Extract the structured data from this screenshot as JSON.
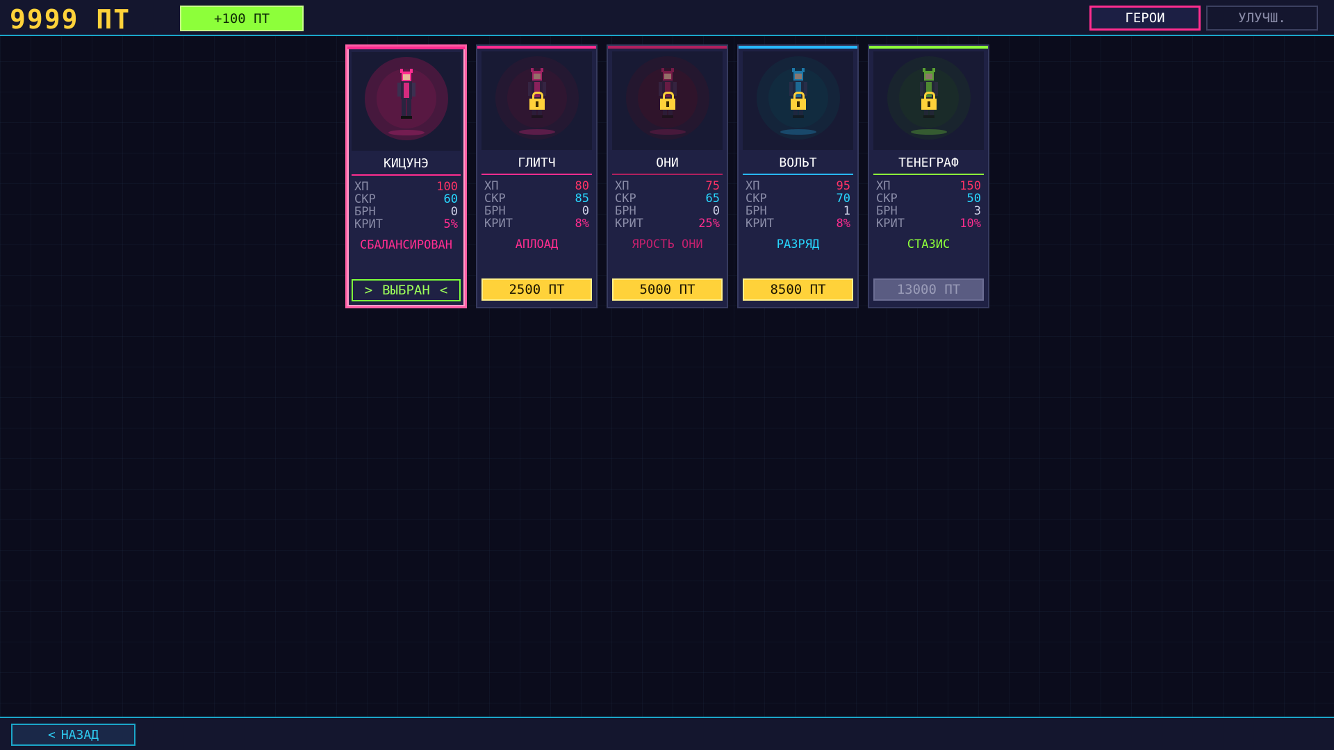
{
  "header": {
    "points": "9999 ПТ",
    "add_points_label": "+100 ПТ",
    "tabs": [
      {
        "label": "ГЕРОИ",
        "active": true
      },
      {
        "label": "УЛУЧШ.",
        "active": false
      }
    ]
  },
  "colors": {
    "points": "#ffd23a",
    "hp": "#ff3366",
    "spd": "#28d7ff",
    "arm": "#d0d2e8",
    "crit": "#ff2d8f",
    "accent_pink": "#ff2d8f",
    "accent_cyan": "#1ba6c9",
    "accent_green": "#8dff3a",
    "cost_yellow": "#ffd23a"
  },
  "stat_labels": {
    "hp": "ХП",
    "spd": "СКР",
    "arm": "БРН",
    "crit": "КРИТ"
  },
  "heroes": [
    {
      "name": "КИЦУНЭ",
      "hp": "100",
      "spd": "60",
      "arm": "0",
      "crit": "5%",
      "ability": "СБАЛАНСИРОВАН",
      "ability_color": "#ff2d8f",
      "cost_label": "ВЫБРАН",
      "state": "selected",
      "locked": false,
      "theme": "#ff2d8f",
      "glow": "#5a1842"
    },
    {
      "name": "ГЛИТЧ",
      "hp": "80",
      "spd": "85",
      "arm": "0",
      "crit": "8%",
      "ability": "АПЛОАД",
      "ability_color": "#ff2d8f",
      "cost_label": "2500 ПТ",
      "state": "buy",
      "locked": true,
      "theme": "#ff2d8f",
      "glow": "#3a1530"
    },
    {
      "name": "ОНИ",
      "hp": "75",
      "spd": "65",
      "arm": "0",
      "crit": "25%",
      "ability": "ЯРОСТЬ ОНИ",
      "ability_color": "#c4206e",
      "cost_label": "5000 ПТ",
      "state": "buy",
      "locked": true,
      "theme": "#b0205e",
      "glow": "#3a1228"
    },
    {
      "name": "ВОЛЬТ",
      "hp": "95",
      "spd": "70",
      "arm": "1",
      "crit": "8%",
      "ability": "РАЗРЯД",
      "ability_color": "#28d7ff",
      "cost_label": "8500 ПТ",
      "state": "buy",
      "locked": true,
      "theme": "#28b8ff",
      "glow": "#0f3344"
    },
    {
      "name": "ТЕНЕГРАФ",
      "hp": "150",
      "spd": "50",
      "arm": "3",
      "crit": "10%",
      "ability": "СТАЗИС",
      "ability_color": "#8dff3a",
      "cost_label": "13000 ПТ",
      "state": "disabled",
      "locked": true,
      "theme": "#8dff3a",
      "glow": "#1c3324"
    }
  ],
  "footer": {
    "back_label": "НАЗАД"
  }
}
